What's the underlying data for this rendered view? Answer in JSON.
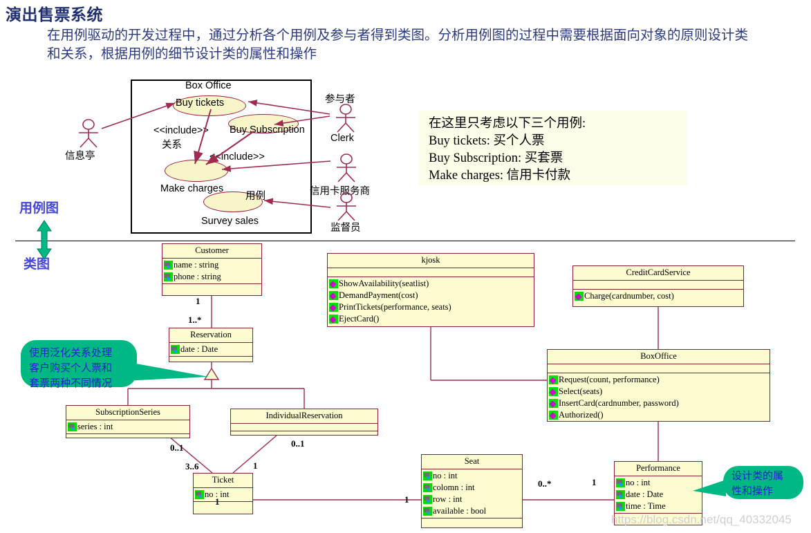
{
  "page": {
    "title": "演出售票系统",
    "intro": "在用例驱动的开发过程中，通过分析各个用例及参与者得到类图。分析用例图的过程中需要根据面向对象的原则设计类和关系，根据用例的细节设计类的属性和操作",
    "watermark": "https://blog.csdn.net/qq_40332045"
  },
  "side_labels": {
    "use_case_diagram": "用例图",
    "class_diagram": "类图"
  },
  "use_case_diagram": {
    "system_boundary_label": "Box Office",
    "use_cases": [
      {
        "id": "buy-tickets",
        "label": "Buy tickets"
      },
      {
        "id": "buy-subscription",
        "label": "Buy Subscription"
      },
      {
        "id": "make-charges",
        "label": "Make charges"
      },
      {
        "id": "survey-sales",
        "label": "Survey sales"
      }
    ],
    "actors": [
      {
        "id": "kiosk",
        "label": "信息亭"
      },
      {
        "id": "clerk",
        "label": "Clerk"
      },
      {
        "id": "credit-card-service",
        "label": "信用卡服务商"
      },
      {
        "id": "supervisor",
        "label": "监督员"
      }
    ],
    "annotations": [
      {
        "id": "include-1",
        "label": "<<include>>"
      },
      {
        "id": "include-2",
        "label": "<<include>>"
      },
      {
        "id": "relation-note",
        "label": "关系"
      },
      {
        "id": "usecase-note",
        "label": "用例"
      },
      {
        "id": "actor-note",
        "label": "参与者"
      }
    ]
  },
  "info_box": {
    "lines": [
      "在这里只考虑以下三个用例:",
      "Buy tickets: 买个人票",
      "Buy Subscription: 买套票",
      "Make charges: 信用卡付款"
    ]
  },
  "class_diagram": {
    "classes": [
      {
        "id": "customer",
        "name": "Customer",
        "attributes": [
          "name : string",
          "phone : string"
        ],
        "operations": []
      },
      {
        "id": "kjosk",
        "name": "kjosk",
        "attributes": [],
        "operations": [
          "ShowAvailability(seatlist)",
          "DemandPayment(cost)",
          "PrintTickets(performance, seats)",
          "EjectCard()"
        ]
      },
      {
        "id": "creditcardservice",
        "name": "CreditCardService",
        "attributes": [],
        "operations": [
          "Charge(cardnumber, cost)"
        ]
      },
      {
        "id": "reservation",
        "name": "Reservation",
        "attributes": [
          "date : Date"
        ],
        "operations": []
      },
      {
        "id": "boxoffice",
        "name": "BoxOffice",
        "attributes": [],
        "operations": [
          "Request(count, performance)",
          "Select(seats)",
          "InsertCard(cardnumber, password)",
          "Authorized()"
        ]
      },
      {
        "id": "subscriptionseries",
        "name": "SubscriptionSeries",
        "attributes": [
          "series : int"
        ],
        "operations": []
      },
      {
        "id": "individualreservation",
        "name": "IndividualReservation",
        "attributes": [],
        "operations": []
      },
      {
        "id": "ticket",
        "name": "Ticket",
        "attributes": [
          "no : int"
        ],
        "operations": []
      },
      {
        "id": "seat",
        "name": "Seat",
        "attributes": [
          "no : int",
          "colomn : int",
          "row : int",
          "available : bool"
        ],
        "operations": []
      },
      {
        "id": "performance",
        "name": "Performance",
        "attributes": [
          "no : int",
          "date : Date",
          "time : Time"
        ],
        "operations": []
      }
    ],
    "multiplicities": [
      {
        "id": "customer-end",
        "value": "1"
      },
      {
        "id": "reservation-end",
        "value": "1..*"
      },
      {
        "id": "subscriptionseries-end",
        "value": "0..1"
      },
      {
        "id": "ticket-from-series",
        "value": "3..6"
      },
      {
        "id": "individualreservation-end",
        "value": "0..1"
      },
      {
        "id": "ticket-from-individual",
        "value": "1"
      },
      {
        "id": "ticket-seat-left",
        "value": "1"
      },
      {
        "id": "ticket-seat-right",
        "value": "1"
      },
      {
        "id": "seat-performance-left",
        "value": "0..*"
      },
      {
        "id": "seat-performance-right",
        "value": "1"
      }
    ],
    "callouts": [
      {
        "id": "generalization-note",
        "lines": [
          "使用泛化关系处理",
          "客户购买个人票和",
          "套票两种不同情况"
        ]
      },
      {
        "id": "attributes-operations-note",
        "lines": [
          "设计类的属",
          "性和操作"
        ]
      }
    ]
  },
  "colors": {
    "title": "#1f2f6e",
    "intro": "#2b3a80",
    "side_label": "#4646d8",
    "class_fill": "#fdfbd0",
    "class_border": "#8d1b3d",
    "usecase_fill": "#f8f5c9",
    "usecase_border": "#9e1b42",
    "callout_fill": "#00b884",
    "callout_text": "#2222cc",
    "relation_line": "#9e2b50",
    "arrow_teal": "#00b884"
  }
}
